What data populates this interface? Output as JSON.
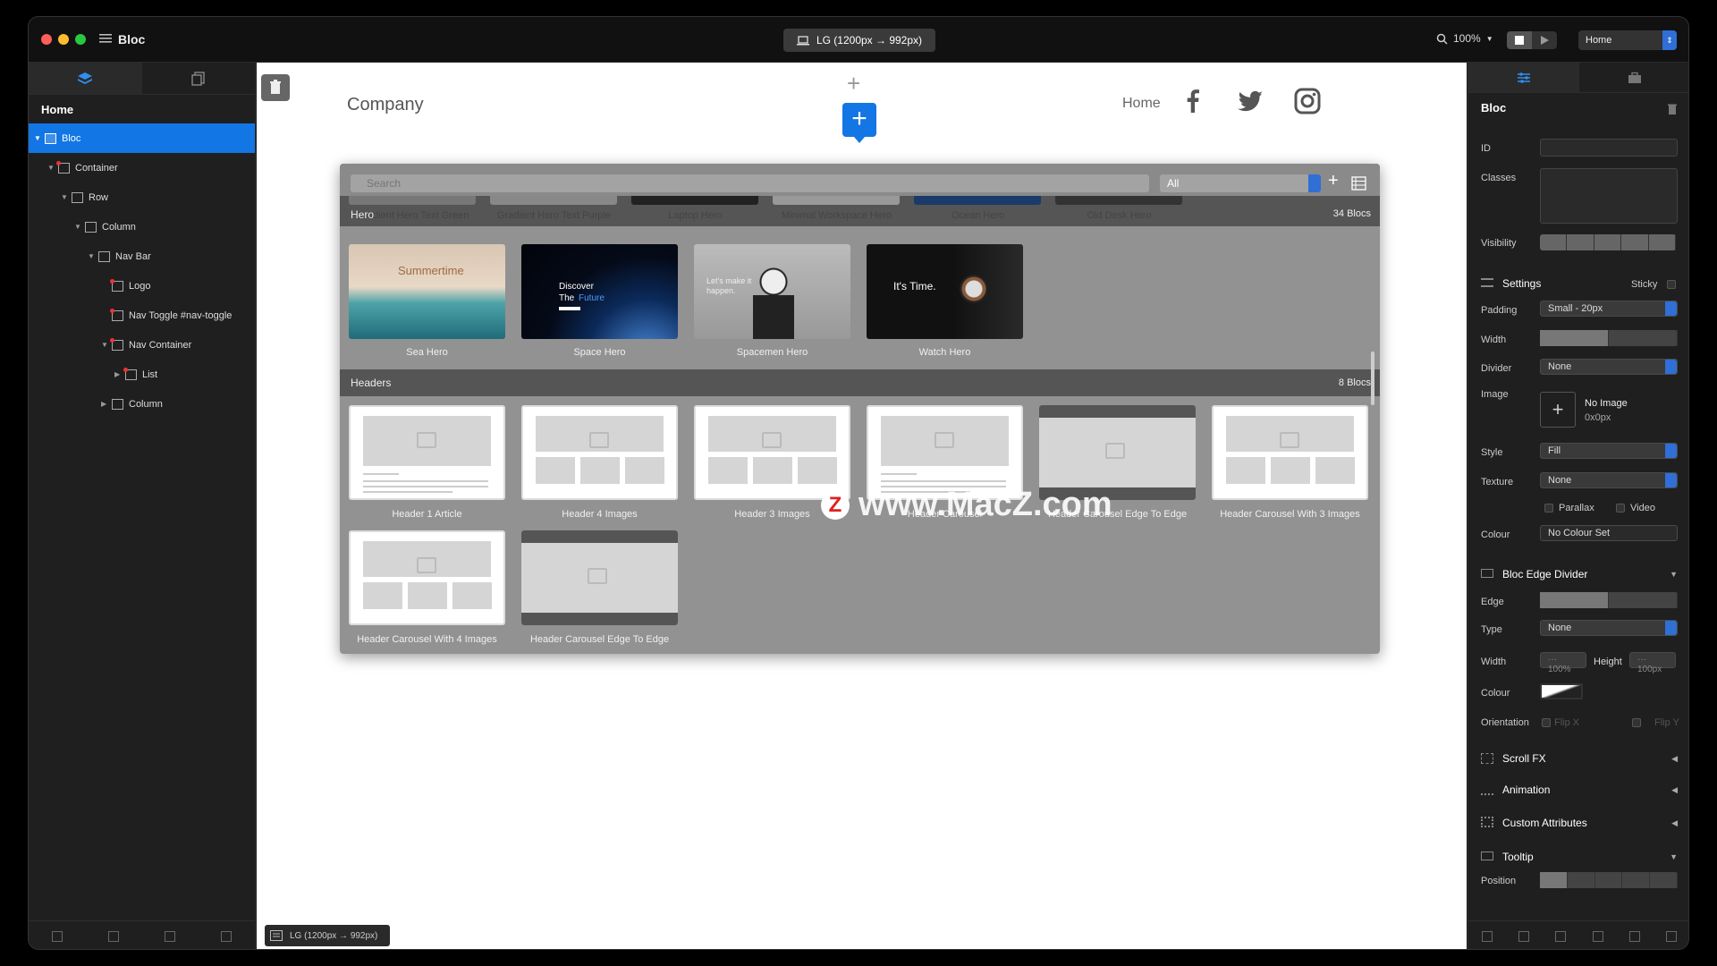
{
  "app": {
    "name": "Bloc"
  },
  "toolbar": {
    "device_label": "LG (1200px → 992px)",
    "zoom": "100%",
    "page_select": "Home"
  },
  "layers": {
    "page": "Home",
    "items": [
      {
        "label": "Bloc",
        "depth": 0,
        "selected": true
      },
      {
        "label": "Container",
        "depth": 1
      },
      {
        "label": "Row",
        "depth": 2
      },
      {
        "label": "Column",
        "depth": 3
      },
      {
        "label": "Nav Bar",
        "depth": 4
      },
      {
        "label": "Logo",
        "depth": 5
      },
      {
        "label": "Nav Toggle #nav-toggle",
        "depth": 5
      },
      {
        "label": "Nav Container",
        "depth": 5
      },
      {
        "label": "List",
        "depth": 6
      },
      {
        "label": "Column",
        "depth": 5
      }
    ]
  },
  "canvas": {
    "company": "Company",
    "nav_home": "Home",
    "bottom_device": "LG (1200px → 992px)"
  },
  "library": {
    "search_placeholder": "Search",
    "filter": "All",
    "hero_top": [
      "Gradient Hero Text Green",
      "Gradient Hero Text Purple",
      "Laptop Hero",
      "Minimal Workspace Hero",
      "Ocean Hero",
      "Old Desk Hero"
    ],
    "hero": {
      "title": "Hero",
      "count": "34 Blocs"
    },
    "hero_items": [
      {
        "label": "Sea Hero",
        "text": "Summertime"
      },
      {
        "label": "Space Hero",
        "text1": "Discover",
        "text2": "The",
        "text3": "Future"
      },
      {
        "label": "Spacemen Hero",
        "text": "Let's make it happen."
      },
      {
        "label": "Watch Hero",
        "text": "It's Time."
      }
    ],
    "headers": {
      "title": "Headers",
      "count": "8 Blocs"
    },
    "header_items": [
      "Header 1 Article",
      "Header 4 Images",
      "Header 3 Images",
      "Header Carousel",
      "Header Carousel Edge To Edge",
      "Header Carousel With 3 Images",
      "Header Carousel With 4 Images",
      "Header Carousel Edge To Edge"
    ],
    "watermark": "www.MacZ.com",
    "watermark_letter": "Z"
  },
  "inspector": {
    "title": "Bloc",
    "id_label": "ID",
    "classes_label": "Classes",
    "visibility_label": "Visibility",
    "settings": "Settings",
    "sticky": "Sticky",
    "padding_label": "Padding",
    "padding_value": "Small - 20px",
    "width_label": "Width",
    "divider_label": "Divider",
    "divider_value": "None",
    "image_label": "Image",
    "image_value": "No Image",
    "image_size": "0x0px",
    "style_label": "Style",
    "style_value": "Fill",
    "texture_label": "Texture",
    "texture_value": "None",
    "parallax": "Parallax",
    "video": "Video",
    "colour_label": "Colour",
    "colour_value": "No Colour Set",
    "edge_divider": "Bloc Edge Divider",
    "edge_label": "Edge",
    "type_label": "Type",
    "type_value": "None",
    "width2_label": "Width",
    "width2_value": "··· 100%",
    "height_label": "Height",
    "height_value": "··· 100px",
    "colour2_label": "Colour",
    "orientation_label": "Orientation",
    "flip_x": "Flip X",
    "flip_y": "Flip Y",
    "scroll_fx": "Scroll FX",
    "animation": "Animation",
    "custom_attributes": "Custom Attributes",
    "tooltip": "Tooltip",
    "position_label": "Position"
  },
  "colors": {
    "accent": "#1276e4",
    "select_arrow": "#2f6fd6"
  }
}
